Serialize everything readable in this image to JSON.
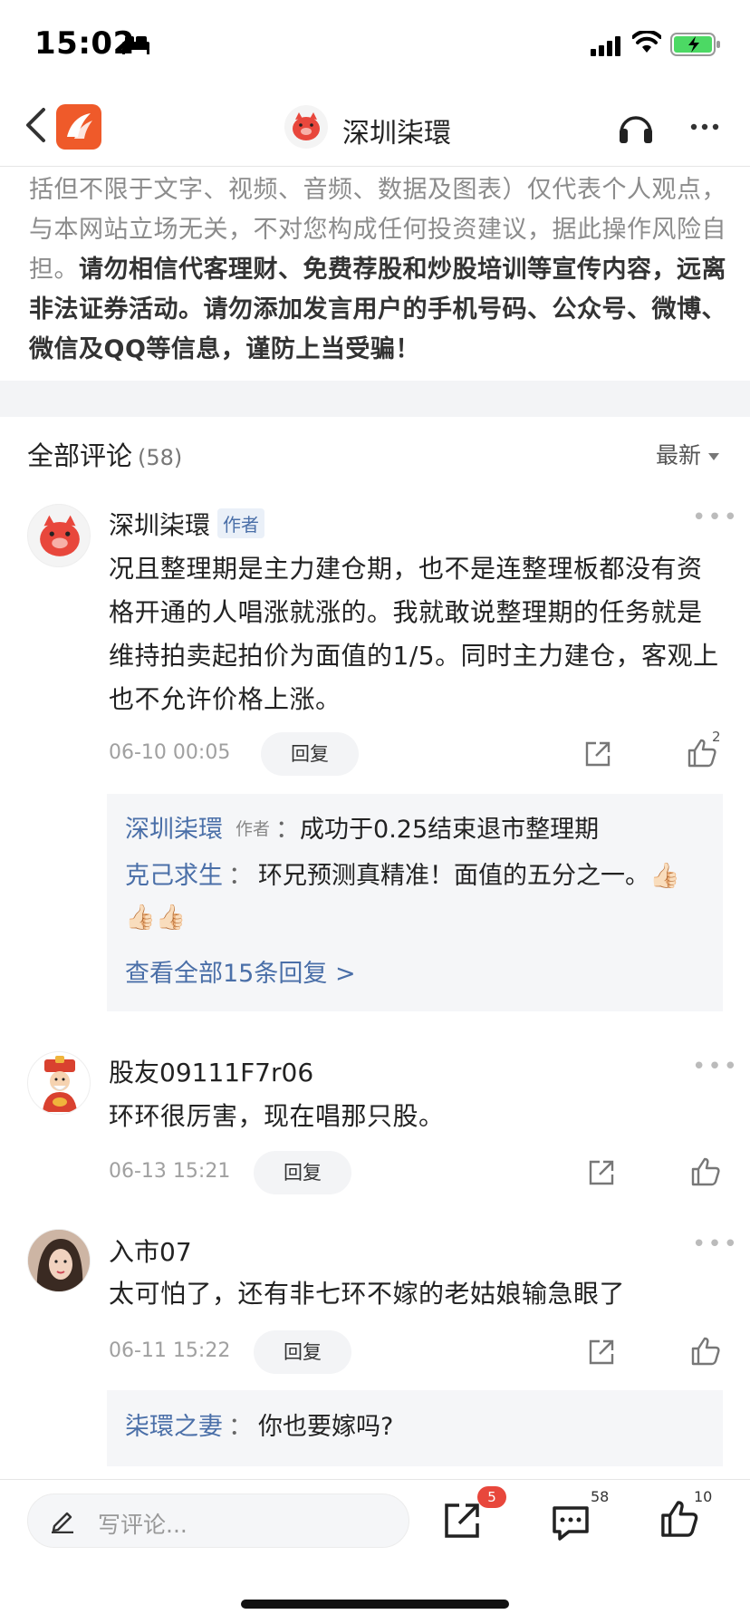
{
  "status_bar": {
    "time": "15:02"
  },
  "nav": {
    "title": "深圳柒環"
  },
  "disclaimer": {
    "gray_text": "括但不限于文字、视频、音频、数据及图表）仅代表个人观点，与本网站立场无关，不对您构成任何投资建议，据此操作风险自担。",
    "bold_text": "请勿相信代客理财、免费荐股和炒股培训等宣传内容，远离非法证券活动。请勿添加发言用户的手机号码、公众号、微博、微信及QQ等信息，谨防上当受骗！"
  },
  "comments_header": {
    "title": "全部评论",
    "count": "(58)",
    "sort_label": "最新"
  },
  "comments": [
    {
      "username": "深圳柒環",
      "badge": "作者",
      "text": "况且整理期是主力建仓期，也不是连整理板都没有资格开通的人唱涨就涨的。我就敢说整理期的任务就是维持拍卖起拍价为面值的1/5。同时主力建仓，客观上也不允许价格上涨。",
      "time": "06-10 00:05",
      "reply_label": "回复",
      "likes": "2",
      "replies": [
        {
          "name": "深圳柒環",
          "badge": "作者",
          "sep": "：",
          "text": "成功于0.25结束退市整理期"
        },
        {
          "name": "克己求生",
          "sep": "：",
          "text": "环兄预测真精准！面值的五分之一。👍🏻👍🏻👍🏻"
        }
      ],
      "view_all": "查看全部15条回复 >"
    },
    {
      "username": "股友09111F7r06",
      "text": "环环很厉害，现在唱那只股。",
      "time": "06-13 15:21",
      "reply_label": "回复"
    },
    {
      "username": "入市07",
      "text": "太可怕了，还有非七环不嫁的老姑娘输急眼了",
      "time": "06-11 15:22",
      "reply_label": "回复",
      "replies": [
        {
          "name": "柒環之妻",
          "sep": "：",
          "text": "你也要嫁吗?"
        }
      ]
    }
  ],
  "bottom_bar": {
    "input_placeholder": "写评论...",
    "share_badge": "5",
    "comment_count": "58",
    "like_count": "10"
  },
  "colors": {
    "accent_blue": "#4a6fa8",
    "brand_orange": "#ef5a2a",
    "badge_red": "#e8473c"
  }
}
